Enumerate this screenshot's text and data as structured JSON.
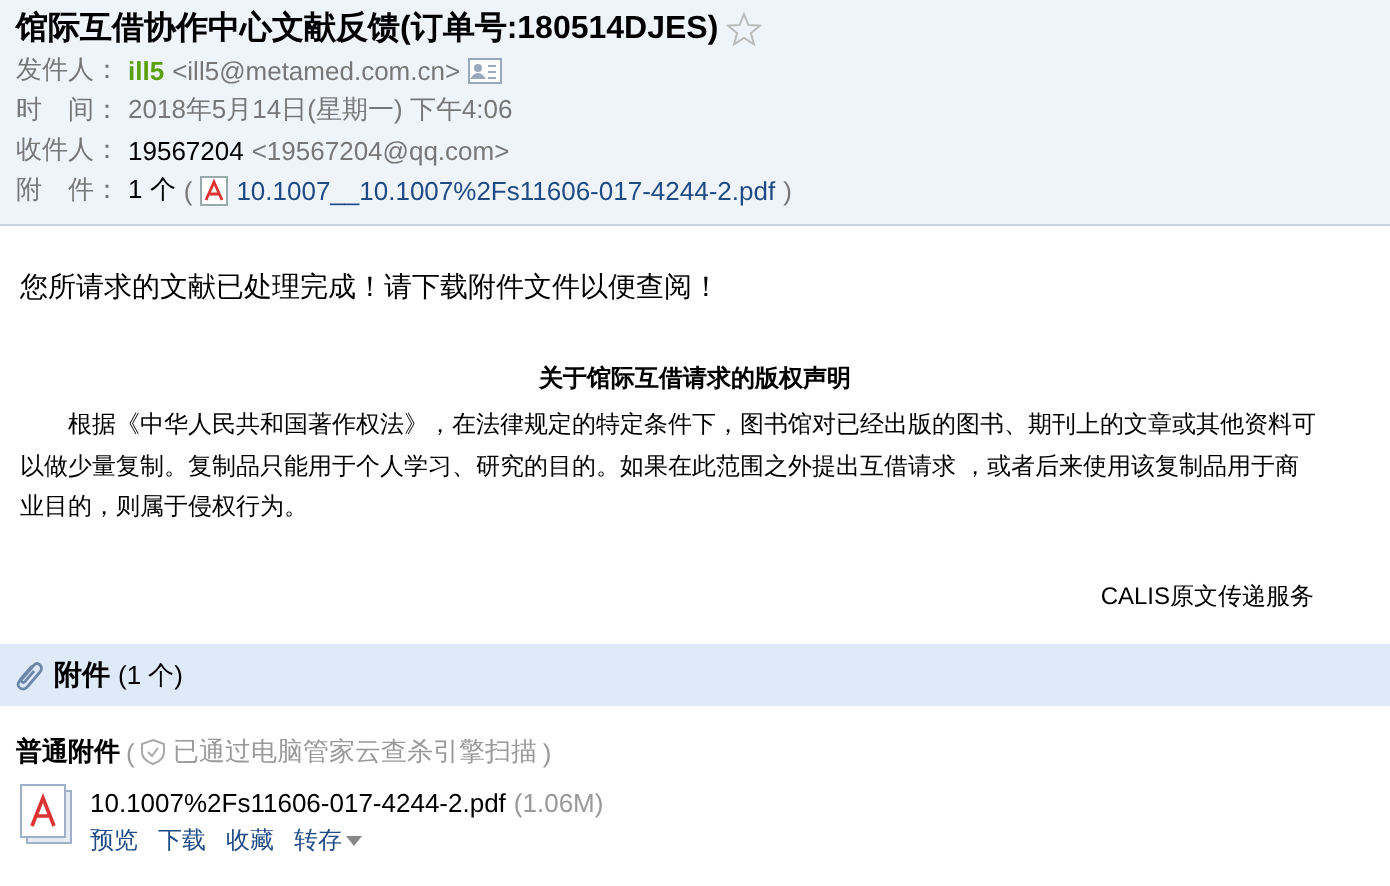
{
  "subject": {
    "title": "馆际互借协作中心文献反馈(订单号:180514DJES)",
    "starred": false
  },
  "header_fields": [
    {
      "kind": "sender",
      "label": "发件人：",
      "name": "ill5",
      "address": "<ill5@metamed.com.cn>"
    },
    {
      "kind": "time",
      "label": "时　间：",
      "value": "2018年5月14日(星期一) 下午4:06"
    },
    {
      "kind": "recipient",
      "label": "收件人：",
      "name": "19567204",
      "address": "<19567204@qq.com>"
    },
    {
      "kind": "attachment",
      "label": "附　件：",
      "count": "1 个",
      "open": "(",
      "file": "10.1007__10.1007%2Fs11606-017-4244-2.pdf",
      "close": ")"
    }
  ],
  "body": {
    "greeting": "您所请求的文献已处理完成！请下载附件文件以便查阅！",
    "notice_title": "关于馆际互借请求的版权声明",
    "notice_text": "根据《中华人民共和国著作权法》，在法律规定的特定条件下，图书馆对已经出版的图书、期刊上的文章或其他资料可以做少量复制。复制品只能用于个人学习、研究的目的。如果在此范围之外提出互借请求 ，或者后来使用该复制品用于商业目的，则属于侵权行为。",
    "signature": "CALIS原文传递服务"
  },
  "attachments": {
    "title": "附件",
    "count": "(1 个)",
    "group": "普通附件",
    "scan_open": "(",
    "scan_note": "已通过电脑管家云查杀引擎扫描",
    "scan_close": ")",
    "files": [
      {
        "name": "10.1007%2Fs11606-017-4244-2.pdf",
        "size": "(1.06M)",
        "actions": [
          {
            "label": "预览",
            "dropdown": false
          },
          {
            "label": "下载",
            "dropdown": false
          },
          {
            "label": "收藏",
            "dropdown": false
          },
          {
            "label": "转存",
            "dropdown": true
          }
        ]
      }
    ]
  }
}
